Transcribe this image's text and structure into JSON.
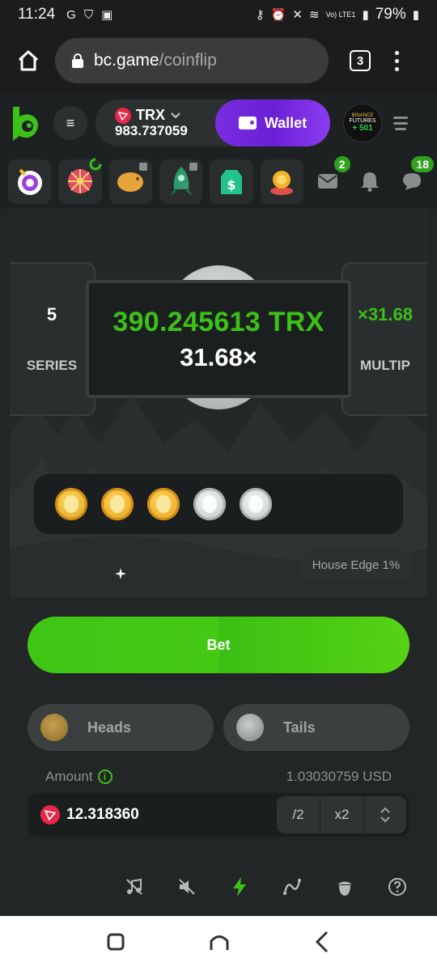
{
  "status_bar": {
    "time": "11:24",
    "battery": "79%",
    "network": "Vo) LTE1"
  },
  "browser": {
    "domain": "bc.game",
    "path": "/coinflip",
    "tab_count": "3"
  },
  "header": {
    "currency": "TRX",
    "balance": "983.737059",
    "wallet_label": "Wallet",
    "promo_line1": "BINANCE",
    "promo_line2": "FUTURES",
    "promo_line3": "+ 501"
  },
  "quick_bar": {
    "mail_badge": "2",
    "chat_badge": "18"
  },
  "game": {
    "series_value": "5",
    "series_label": "SERIES",
    "multiplier_value": "×31.68",
    "multiplier_label": "MULTIP",
    "result_amount": "390.245613 TRX",
    "result_multiplier": "31.68×",
    "history": [
      "gold",
      "gold",
      "gold",
      "silver",
      "silver"
    ],
    "house_edge": "House Edge 1%"
  },
  "controls": {
    "bet_label": "Bet",
    "heads_label": "Heads",
    "tails_label": "Tails",
    "amount_label": "Amount",
    "amount_usd": "1.03030759 USD",
    "amount_value": "12.318360",
    "half_label": "/2",
    "double_label": "x2"
  },
  "colors": {
    "accent_green": "#3bc117",
    "wallet_purple": "#7a2ee0",
    "background": "#232626"
  }
}
